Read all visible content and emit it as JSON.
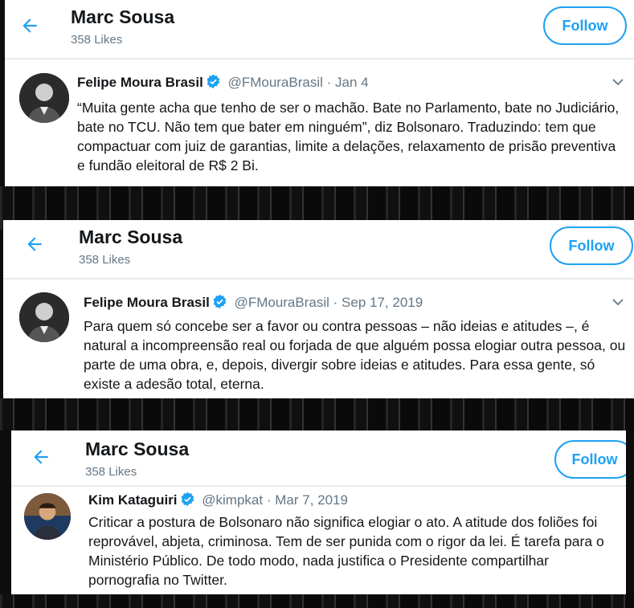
{
  "icons": {
    "back": "arrow-left-icon",
    "verified": "verified-badge-icon",
    "caret": "chevron-down-icon"
  },
  "colors": {
    "accent": "#1da1f2",
    "text": "#14171a",
    "secondary": "#657786"
  },
  "screenshots": [
    {
      "profile_name": "Marc Sousa",
      "likes": "358 Likes",
      "follow_label": "Follow",
      "tweet": {
        "author": "Felipe Moura Brasil",
        "handle": "@FMouraBrasil",
        "separator": "·",
        "date": "Jan 4",
        "text": "“Muita gente acha que tenho de ser o machão. Bate no Parlamento, bate no Judiciário, bate no TCU. Não tem que bater em ninguém”, diz Bolsonaro. Traduzindo: tem que compactuar com juiz de garantias, limite a delações, relaxamento de prisão preventiva e fundão eleitoral de R$ 2 Bi."
      }
    },
    {
      "profile_name": "Marc Sousa",
      "likes": "358 Likes",
      "follow_label": "Follow",
      "tweet": {
        "author": "Felipe Moura Brasil",
        "handle": "@FMouraBrasil",
        "separator": "·",
        "date": "Sep 17, 2019",
        "text": "Para quem só concebe ser a favor ou contra pessoas – não ideias e atitudes –, é natural a incompreensão real ou forjada de que alguém possa elogiar outra pessoa, ou parte de uma obra, e, depois, divergir sobre ideias e atitudes. Para essa gente, só existe a adesão total, eterna."
      }
    },
    {
      "profile_name": "Marc Sousa",
      "likes": "358 Likes",
      "follow_label": "Follow",
      "tweet": {
        "author": "Kim Kataguiri",
        "handle": "@kimpkat",
        "separator": "·",
        "date": "Mar 7, 2019",
        "text": "Criticar a postura de Bolsonaro não significa elogiar o ato. A atitude dos foliões foi reprovável, abjeta, criminosa. Tem de ser punida com o rigor da lei. É tarefa para o Ministério Público. De todo modo, nada justifica o Presidente compartilhar pornografia no Twitter."
      }
    }
  ]
}
